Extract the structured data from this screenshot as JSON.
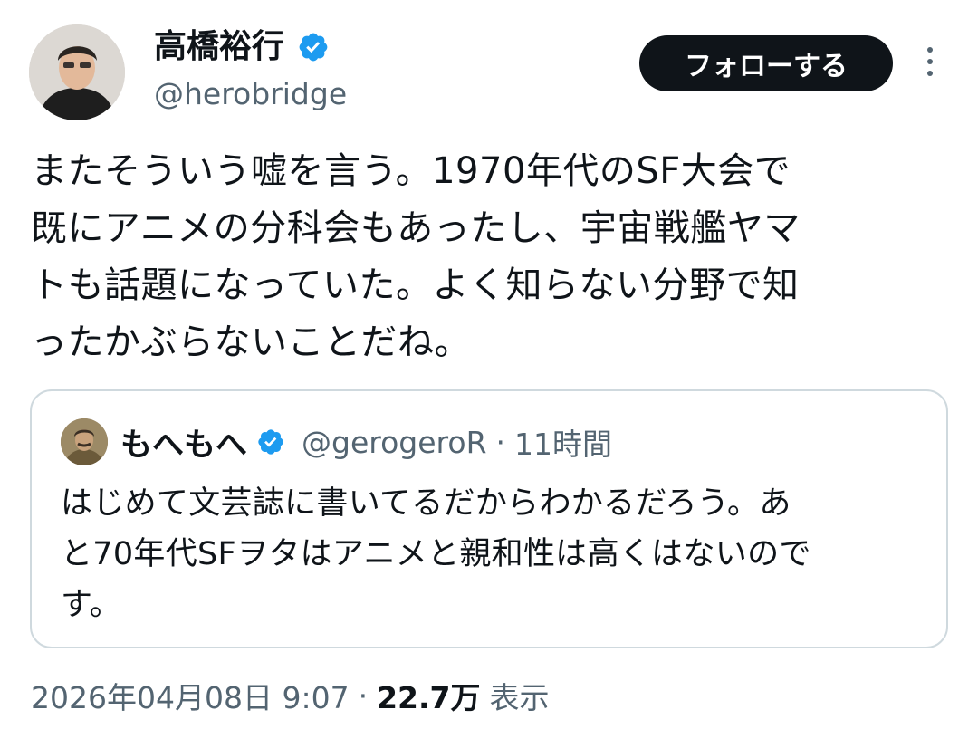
{
  "author": {
    "name": "高橋裕行",
    "handle": "@herobridge",
    "verified_color": "#1d9bf0"
  },
  "actions": {
    "follow_label": "フォローする",
    "more_icon": "more-vertical-icon"
  },
  "tweet": {
    "lines": [
      "またそういう嘘を言う。1970年代のSF大会で",
      "既にアニメの分科会もあったし、宇宙戦艦ヤマ",
      "トも話題になっていた。よく知らない分野で知",
      "ったかぶらないことだね。"
    ]
  },
  "quote": {
    "name": "もへもへ",
    "handle": "@gerogeroR",
    "separator": "·",
    "time": "11時間",
    "lines": [
      "はじめて文芸誌に書いてるだからわかるだろう。あ",
      "と70年代SFヲタはアニメと親和性は高くはないので",
      "す。"
    ]
  },
  "meta": {
    "date": "2026年04月08日 9:07",
    "separator": "·",
    "views_count": "22.7万",
    "views_label": "表示"
  }
}
